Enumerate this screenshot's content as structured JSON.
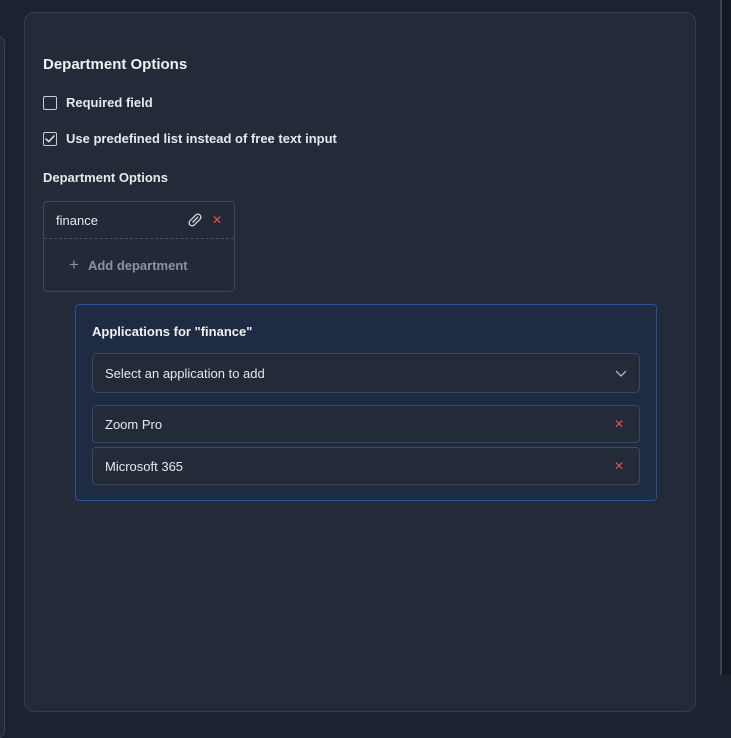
{
  "section": {
    "title": "Department Options"
  },
  "options": {
    "required": {
      "label": "Required field",
      "checked": false
    },
    "predefined": {
      "label": "Use predefined list instead of free text input",
      "checked": true
    }
  },
  "departments": {
    "label": "Department Options",
    "items": [
      {
        "name": "finance",
        "icons": [
          "paperclip-icon",
          "close-icon"
        ]
      }
    ],
    "add_label": "Add department",
    "add_icon": "plus-icon"
  },
  "applications": {
    "title": "Applications for \"finance\"",
    "select_placeholder": "Select an application to add",
    "select_icon": "chevron-down-icon",
    "items": [
      {
        "name": "Zoom Pro"
      },
      {
        "name": "Microsoft 365"
      }
    ]
  },
  "colors": {
    "background": "#232b38",
    "accent_border": "#2c4f9a",
    "danger": "#e05252",
    "muted": "#8a93a1"
  }
}
